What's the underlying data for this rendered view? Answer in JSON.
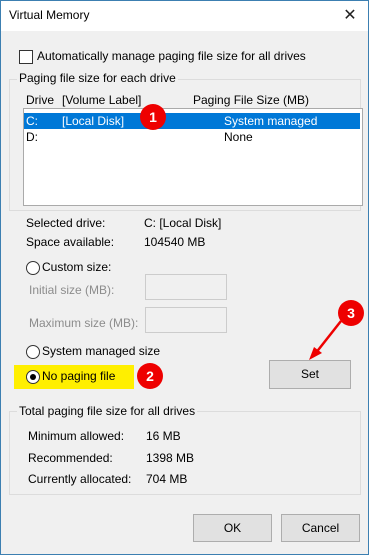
{
  "window": {
    "title": "Virtual Memory",
    "close_glyph": "✕"
  },
  "auto_manage": {
    "label": "Automatically manage paging file size for all drives",
    "checked": false
  },
  "per_drive": {
    "group_label": "Paging file size for each drive",
    "headers": {
      "drive": "Drive",
      "volume": "[Volume Label]",
      "size": "Paging File Size (MB)"
    },
    "rows": [
      {
        "drive": "C:",
        "volume": "[Local Disk]",
        "size": "System managed",
        "selected": true
      },
      {
        "drive": "D:",
        "volume": "",
        "size": "None",
        "selected": false
      }
    ]
  },
  "selected_drive": {
    "label": "Selected drive:",
    "value": "C:  [Local Disk]"
  },
  "space_available": {
    "label": "Space available:",
    "value": "104540 MB"
  },
  "custom_size": {
    "label": "Custom size:",
    "initial_label": "Initial size (MB):",
    "maximum_label": "Maximum size (MB):"
  },
  "system_managed": {
    "label": "System managed size"
  },
  "no_paging": {
    "label": "No paging file",
    "checked": true
  },
  "set_button": {
    "label": "Set"
  },
  "totals": {
    "group_label": "Total paging file size for all drives",
    "minimum_label": "Minimum allowed:",
    "minimum_value": "16 MB",
    "recommended_label": "Recommended:",
    "recommended_value": "1398 MB",
    "allocated_label": "Currently allocated:",
    "allocated_value": "704 MB"
  },
  "buttons": {
    "ok": "OK",
    "cancel": "Cancel"
  },
  "annotations": {
    "badge1": "1",
    "badge2": "2",
    "badge3": "3",
    "badge_color": "#e00000",
    "highlight_color": "#ffef00"
  }
}
